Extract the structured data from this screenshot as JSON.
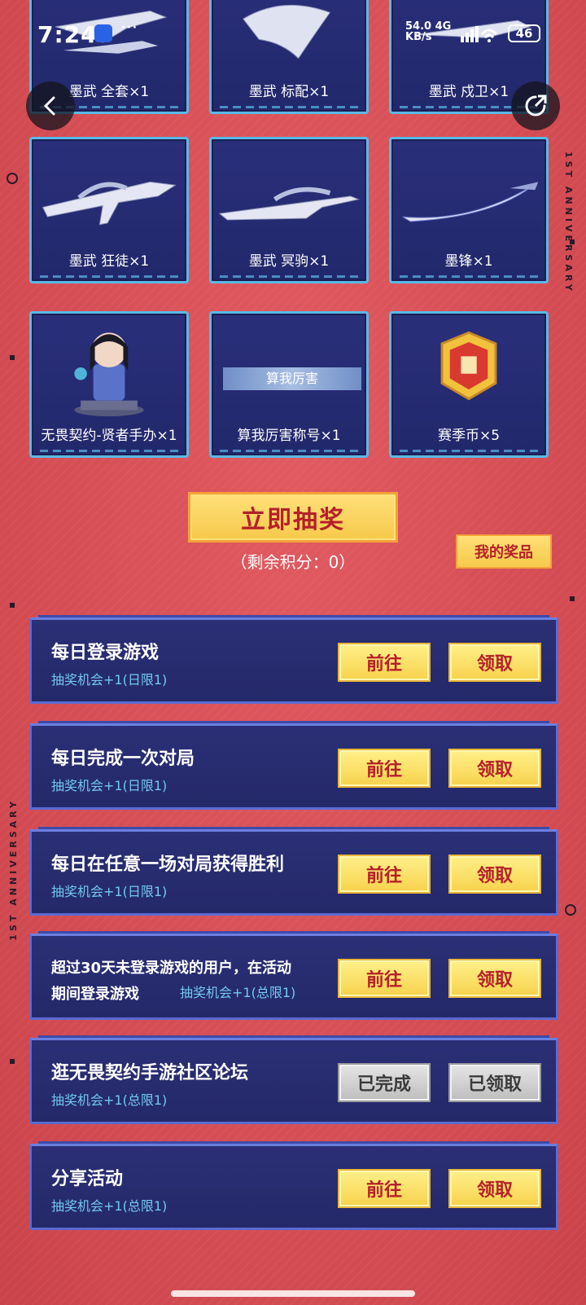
{
  "status_bar": {
    "time": "7:24",
    "dots": "···",
    "net_speed": "54.0",
    "net_unit": "KB/s",
    "net_type": "4G",
    "battery": "46"
  },
  "nav": {
    "back_icon": "chevron-left-icon",
    "share_icon": "share-icon"
  },
  "decor": {
    "side_text": "1ST ANNIVERSARY"
  },
  "rewards": [
    {
      "label": "墨武 全套×1"
    },
    {
      "label": "墨武 标配×1"
    },
    {
      "label": "墨武 戍卫×1"
    },
    {
      "label": "墨武 狂徒×1"
    },
    {
      "label": "墨武 冥驹×1"
    },
    {
      "label": "墨锋×1"
    },
    {
      "label": "无畏契约-贤者手办×1"
    },
    {
      "label": "算我厉害称号×1",
      "badge": "算我厉害"
    },
    {
      "label": "赛季币×5"
    }
  ],
  "draw": {
    "button_label": "立即抽奖",
    "points_text": "（剩余积分：0）",
    "my_prizes_label": "我的奖品"
  },
  "tasks": [
    {
      "title": "每日登录游戏",
      "sub": "抽奖机会+1(日限1)",
      "go_label": "前往",
      "claim_label": "领取"
    },
    {
      "title": "每日完成一次对局",
      "sub": "抽奖机会+1(日限1)",
      "go_label": "前往",
      "claim_label": "领取"
    },
    {
      "title": "每日在任意一场对局获得胜利",
      "sub": "抽奖机会+1(日限1)",
      "go_label": "前往",
      "claim_label": "领取"
    },
    {
      "title_line1": "超过30天未登录游戏的用户，在活动",
      "title_line2": "期间登录游戏",
      "sub": "抽奖机会+1(总限1)",
      "go_label": "前往",
      "claim_label": "领取"
    },
    {
      "title": "逛无畏契约手游社区论坛",
      "sub": "抽奖机会+1(总限1)",
      "go_label": "已完成",
      "claim_label": "已领取"
    },
    {
      "title": "分享活动",
      "sub": "抽奖机会+1(总限1)",
      "go_label": "前往",
      "claim_label": "领取"
    }
  ]
}
